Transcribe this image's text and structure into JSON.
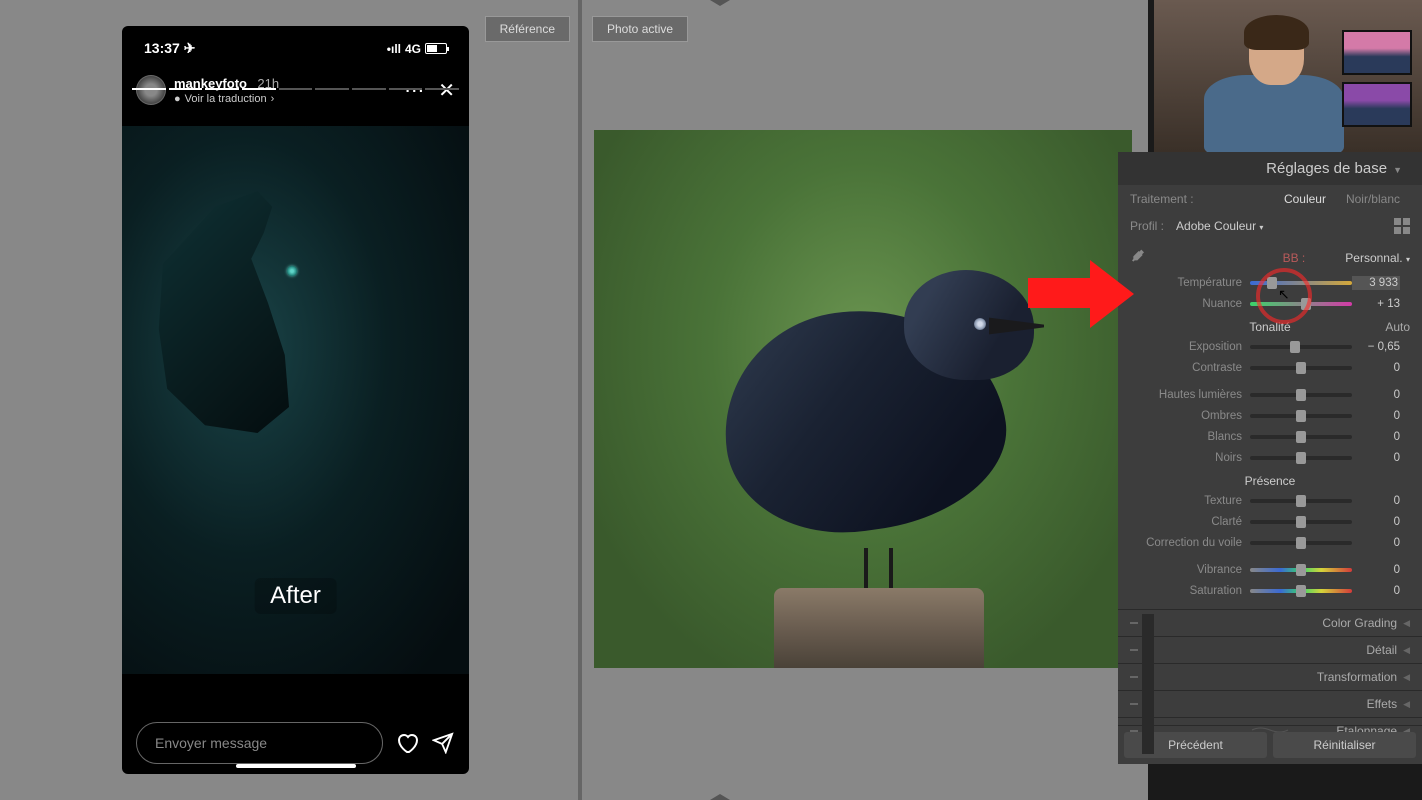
{
  "tabs": {
    "reference": "Référence",
    "active": "Photo active"
  },
  "phone": {
    "time": "13:37",
    "net": "4G",
    "user": "mankeyfoto",
    "age": "21h",
    "translate": "Voir la traduction",
    "after": "After",
    "placeholder": "Envoyer message"
  },
  "panel": {
    "title": "Réglages de base",
    "treatment_label": "Traitement :",
    "color": "Couleur",
    "bw": "Noir/blanc",
    "profile_label": "Profil :",
    "profile_value": "Adobe Couleur",
    "wb_label": "BB :",
    "wb_value": "Personnal.",
    "tone_title": "Tonalité",
    "auto": "Auto",
    "presence_title": "Présence",
    "sliders": {
      "temp": {
        "label": "Température",
        "value": "3 933",
        "pos": 22
      },
      "tint": {
        "label": "Nuance",
        "value": "+ 13",
        "pos": 55
      },
      "exp": {
        "label": "Exposition",
        "value": "− 0,65",
        "pos": 44
      },
      "contrast": {
        "label": "Contraste",
        "value": "0",
        "pos": 50
      },
      "highlights": {
        "label": "Hautes lumières",
        "value": "0",
        "pos": 50
      },
      "shadows": {
        "label": "Ombres",
        "value": "0",
        "pos": 50
      },
      "whites": {
        "label": "Blancs",
        "value": "0",
        "pos": 50
      },
      "blacks": {
        "label": "Noirs",
        "value": "0",
        "pos": 50
      },
      "texture": {
        "label": "Texture",
        "value": "0",
        "pos": 50
      },
      "clarity": {
        "label": "Clarté",
        "value": "0",
        "pos": 50
      },
      "dehaze": {
        "label": "Correction du voile",
        "value": "0",
        "pos": 50
      },
      "vibrance": {
        "label": "Vibrance",
        "value": "0",
        "pos": 50
      },
      "saturation": {
        "label": "Saturation",
        "value": "0",
        "pos": 50
      }
    },
    "collapsed": {
      "colorgrading": "Color Grading",
      "detail": "Détail",
      "transform": "Transformation",
      "effects": "Effets",
      "calib": "Etalonnage"
    },
    "footer": {
      "prev": "Précédent",
      "reset": "Réinitialiser"
    }
  }
}
